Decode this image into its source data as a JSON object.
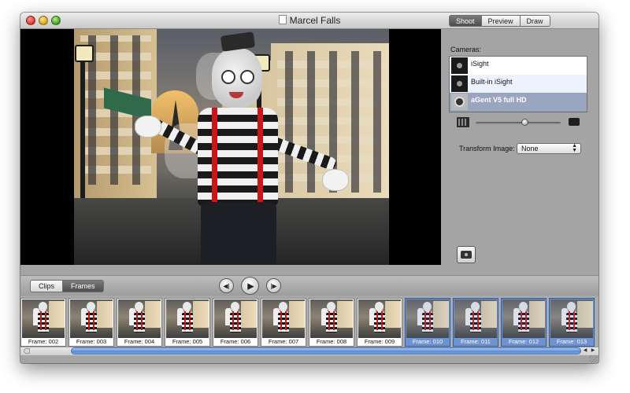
{
  "window": {
    "title": "Marcel Falls"
  },
  "mode_tabs": [
    {
      "label": "Shoot",
      "active": true
    },
    {
      "label": "Preview",
      "active": false
    },
    {
      "label": "Draw",
      "active": false
    }
  ],
  "cameras": {
    "label": "Cameras:",
    "items": [
      {
        "name": "iSight",
        "selected": false
      },
      {
        "name": "Built-in iSight",
        "selected": false
      },
      {
        "name": "aGent V5 full HD",
        "selected": true
      }
    ]
  },
  "onion_skin_slider": {
    "value": 0.57
  },
  "transform": {
    "label": "Transform Image:",
    "value": "None"
  },
  "view_tabs": [
    {
      "label": "Clips",
      "active": false
    },
    {
      "label": "Frames",
      "active": true
    }
  ],
  "transport": {
    "prev_icon": "step-back-icon",
    "play_icon": "play-icon",
    "next_icon": "step-forward-icon"
  },
  "frames": [
    {
      "label": "Frame: 002",
      "selected": false
    },
    {
      "label": "Frame: 003",
      "selected": false
    },
    {
      "label": "Frame: 004",
      "selected": false
    },
    {
      "label": "Frame: 005",
      "selected": false
    },
    {
      "label": "Frame: 006",
      "selected": false
    },
    {
      "label": "Frame: 007",
      "selected": false
    },
    {
      "label": "Frame: 008",
      "selected": false
    },
    {
      "label": "Frame: 009",
      "selected": false
    },
    {
      "label": "Frame: 010",
      "selected": true
    },
    {
      "label": "Frame: 011",
      "selected": true
    },
    {
      "label": "Frame: 012",
      "selected": true
    },
    {
      "label": "Frame: 013",
      "selected": true
    }
  ],
  "colors": {
    "selection": "#6f93d0",
    "camera_selected": "#9aa5c0",
    "scroll_thumb": "#5b8bd6"
  }
}
